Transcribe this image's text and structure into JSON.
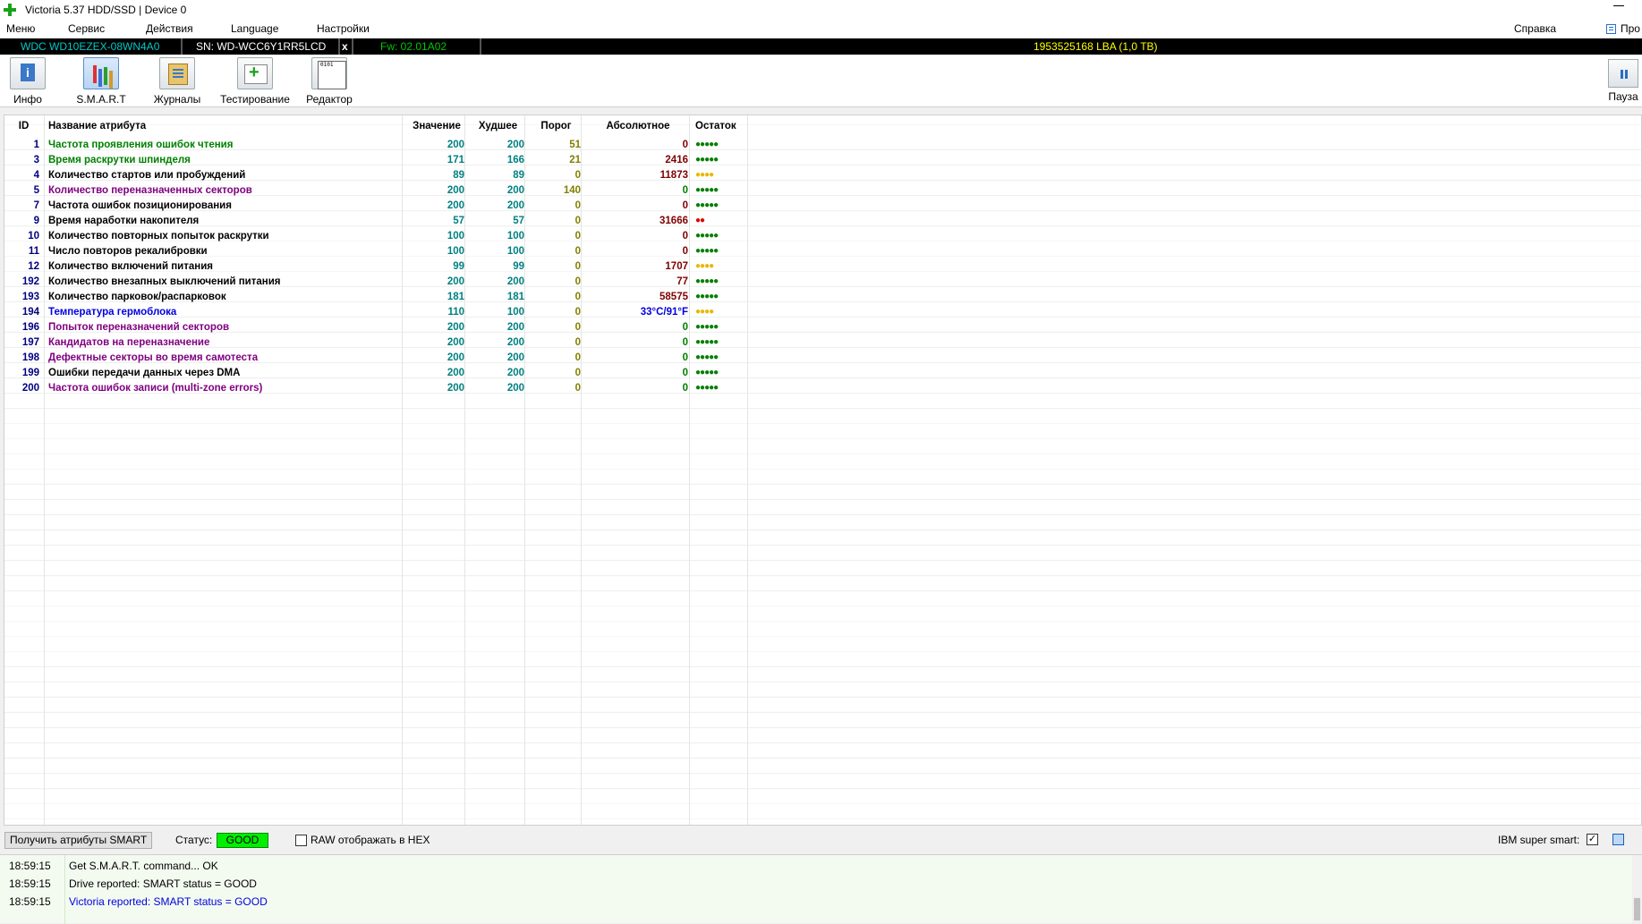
{
  "window": {
    "title": "Victoria 5.37 HDD/SSD | Device 0"
  },
  "menu": {
    "items": [
      "Меню",
      "Сервис",
      "Действия",
      "Language",
      "Настройки"
    ],
    "help": "Справка",
    "pro": "Про"
  },
  "drive": {
    "model": "WDC WD10EZEX-08WN4A0",
    "serial": "SN: WD-WCC6Y1RR5LCD",
    "close": "x",
    "firmware": "Fw: 02.01A02",
    "capacity": "1953525168 LBA (1,0 TB)"
  },
  "toolbar": {
    "info": "Инфо",
    "smart": "S.M.A.R.T",
    "logs": "Журналы",
    "testing": "Тестирование",
    "editor": "Редактор",
    "pause": "Пауза"
  },
  "table": {
    "headers": {
      "id": "ID",
      "name": "Название атрибута",
      "value": "Значение",
      "worst": "Худшее",
      "threshold": "Порог",
      "raw": "Абсолютное",
      "health": "Остаток"
    },
    "rows": [
      {
        "id": "1",
        "name": "Частота проявления ошибок чтения",
        "value": "200",
        "worst": "200",
        "threshold": "51",
        "raw": "0",
        "health": "●●●●●",
        "name_color": "#008000",
        "raw_color": "#800000",
        "thr_color": "#808000",
        "health_color": "#008000"
      },
      {
        "id": "3",
        "name": "Время раскрутки шпинделя",
        "value": "171",
        "worst": "166",
        "threshold": "21",
        "raw": "2416",
        "health": "●●●●●",
        "name_color": "#008000",
        "raw_color": "#800000",
        "thr_color": "#808000",
        "health_color": "#008000"
      },
      {
        "id": "4",
        "name": "Количество стартов или пробуждений",
        "value": "89",
        "worst": "89",
        "threshold": "0",
        "raw": "11873",
        "health": "●●●●",
        "name_color": "#000000",
        "raw_color": "#800000",
        "thr_color": "#808000",
        "health_color": "#e8b800"
      },
      {
        "id": "5",
        "name": "Количество переназначенных секторов",
        "value": "200",
        "worst": "200",
        "threshold": "140",
        "raw": "0",
        "health": "●●●●●",
        "name_color": "#800080",
        "raw_color": "#008000",
        "thr_color": "#808000",
        "health_color": "#008000"
      },
      {
        "id": "7",
        "name": "Частота ошибок позиционирования",
        "value": "200",
        "worst": "200",
        "threshold": "0",
        "raw": "0",
        "health": "●●●●●",
        "name_color": "#000000",
        "raw_color": "#800000",
        "thr_color": "#808000",
        "health_color": "#008000"
      },
      {
        "id": "9",
        "name": "Время наработки накопителя",
        "value": "57",
        "worst": "57",
        "threshold": "0",
        "raw": "31666",
        "health": "●●",
        "name_color": "#000000",
        "raw_color": "#800000",
        "thr_color": "#808000",
        "health_color": "#e00000"
      },
      {
        "id": "10",
        "name": "Количество повторных попыток раскрутки",
        "value": "100",
        "worst": "100",
        "threshold": "0",
        "raw": "0",
        "health": "●●●●●",
        "name_color": "#000000",
        "raw_color": "#800000",
        "thr_color": "#808000",
        "health_color": "#008000"
      },
      {
        "id": "11",
        "name": "Число повторов рекалибровки",
        "value": "100",
        "worst": "100",
        "threshold": "0",
        "raw": "0",
        "health": "●●●●●",
        "name_color": "#000000",
        "raw_color": "#800000",
        "thr_color": "#808000",
        "health_color": "#008000"
      },
      {
        "id": "12",
        "name": "Количество включений питания",
        "value": "99",
        "worst": "99",
        "threshold": "0",
        "raw": "1707",
        "health": "●●●●",
        "name_color": "#000000",
        "raw_color": "#800000",
        "thr_color": "#808000",
        "health_color": "#e8b800"
      },
      {
        "id": "192",
        "name": "Количество внезапных выключений питания",
        "value": "200",
        "worst": "200",
        "threshold": "0",
        "raw": "77",
        "health": "●●●●●",
        "name_color": "#000000",
        "raw_color": "#800000",
        "thr_color": "#808000",
        "health_color": "#008000"
      },
      {
        "id": "193",
        "name": "Количество парковок/распарковок",
        "value": "181",
        "worst": "181",
        "threshold": "0",
        "raw": "58575",
        "health": "●●●●●",
        "name_color": "#000000",
        "raw_color": "#800000",
        "thr_color": "#808000",
        "health_color": "#008000"
      },
      {
        "id": "194",
        "name": "Температура гермоблока",
        "value": "110",
        "worst": "100",
        "threshold": "0",
        "raw": "33°C/91°F",
        "health": "●●●●",
        "name_color": "#0000e0",
        "raw_color": "#0000e0",
        "thr_color": "#808000",
        "health_color": "#e8b800"
      },
      {
        "id": "196",
        "name": "Попыток переназначений секторов",
        "value": "200",
        "worst": "200",
        "threshold": "0",
        "raw": "0",
        "health": "●●●●●",
        "name_color": "#800080",
        "raw_color": "#008000",
        "thr_color": "#808000",
        "health_color": "#008000"
      },
      {
        "id": "197",
        "name": "Кандидатов на переназначение",
        "value": "200",
        "worst": "200",
        "threshold": "0",
        "raw": "0",
        "health": "●●●●●",
        "name_color": "#800080",
        "raw_color": "#008000",
        "thr_color": "#808000",
        "health_color": "#008000"
      },
      {
        "id": "198",
        "name": "Дефектные секторы во время самотеста",
        "value": "200",
        "worst": "200",
        "threshold": "0",
        "raw": "0",
        "health": "●●●●●",
        "name_color": "#800080",
        "raw_color": "#008000",
        "thr_color": "#808000",
        "health_color": "#008000"
      },
      {
        "id": "199",
        "name": "Ошибки передачи данных через DMA",
        "value": "200",
        "worst": "200",
        "threshold": "0",
        "raw": "0",
        "health": "●●●●●",
        "name_color": "#000000",
        "raw_color": "#008000",
        "thr_color": "#808000",
        "health_color": "#008000"
      },
      {
        "id": "200",
        "name": "Частота ошибок записи (multi-zone errors)",
        "value": "200",
        "worst": "200",
        "threshold": "0",
        "raw": "0",
        "health": "●●●●●",
        "name_color": "#800080",
        "raw_color": "#008000",
        "thr_color": "#808000",
        "health_color": "#008000"
      }
    ]
  },
  "status": {
    "get_smart_button": "Получить атрибуты SMART",
    "status_label": "Статус:",
    "status_value": "GOOD",
    "raw_hex_label": "RAW отображать в HEX",
    "ibm_label": "IBM super smart:",
    "ibm_check": "✓"
  },
  "log": [
    {
      "time": "18:59:15",
      "text": "Get S.M.A.R.T. command... OK",
      "color": "#000000"
    },
    {
      "time": "18:59:15",
      "text": "Drive reported: SMART status = GOOD",
      "color": "#000000"
    },
    {
      "time": "18:59:15",
      "text": "Victoria reported: SMART status = GOOD",
      "color": "#0000e0"
    }
  ],
  "colors": {
    "id": "#000080",
    "value": "#008080",
    "drive_model": "#00c8c8",
    "firmware": "#00c800",
    "capacity": "#ffff00"
  }
}
